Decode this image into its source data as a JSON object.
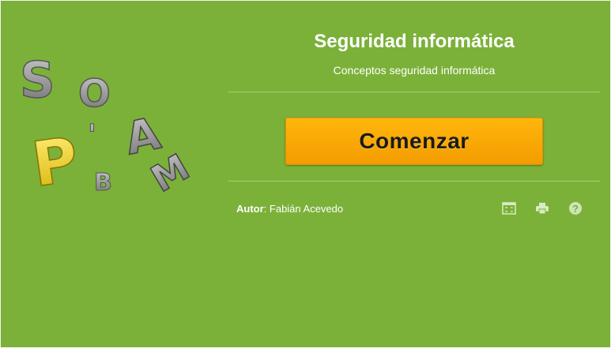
{
  "header": {
    "title": "Seguridad informática",
    "subtitle": "Conceptos seguridad informática"
  },
  "actions": {
    "start_label": "Comenzar"
  },
  "footer": {
    "author_label": "Autor",
    "author_name": ": Fabián Acevedo",
    "help_glyph": "?"
  },
  "logo": {
    "letters": [
      "S",
      "O",
      "P",
      "B",
      "A",
      "M",
      "'"
    ]
  },
  "icons": [
    "fullscreen-icon",
    "print-icon",
    "help-icon"
  ],
  "colors": {
    "background": "#7bb139",
    "button": "#f9a800",
    "text": "#ffffff"
  }
}
